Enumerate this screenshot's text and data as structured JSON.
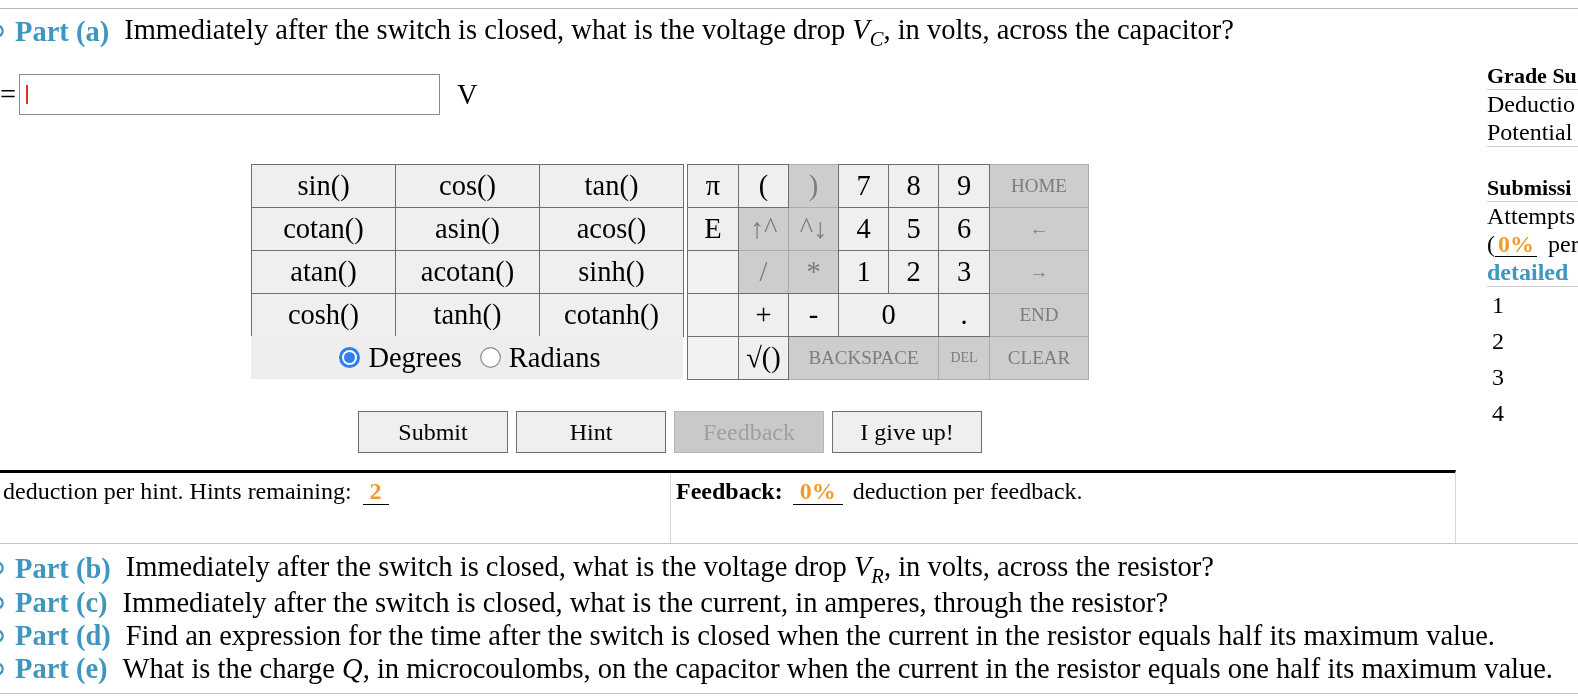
{
  "active_part": {
    "label": "Part (a)",
    "question": "Immediately after the switch is closed, what is the voltage drop *V*$_{C}$, in volts, across the capacitor?",
    "answer": {
      "prefix": "=",
      "unit": "V",
      "focused": true
    },
    "functions": [
      "sin()",
      "cos()",
      "tan()",
      "cotan()",
      "asin()",
      "acos()",
      "atan()",
      "acotan()",
      "sinh()",
      "cosh()",
      "tanh()",
      "cotanh()"
    ],
    "angle_modes": [
      {
        "label": "Degrees",
        "selected": true
      },
      {
        "label": "Radians",
        "selected": false
      }
    ],
    "keys": [
      {
        "label": "π",
        "kind": "char",
        "disabled": false
      },
      {
        "label": "(",
        "kind": "char",
        "disabled": false
      },
      {
        "label": ")",
        "kind": "char",
        "disabled": true
      },
      {
        "label": "7",
        "kind": "char",
        "disabled": false
      },
      {
        "label": "8",
        "kind": "char",
        "disabled": false
      },
      {
        "label": "9",
        "kind": "char",
        "disabled": false
      },
      {
        "label": "HOME",
        "kind": "command",
        "disabled": true
      },
      {
        "label": "E",
        "kind": "char",
        "disabled": false
      },
      {
        "label": "↑^",
        "kind": "char",
        "disabled": true
      },
      {
        "label": "^↓",
        "kind": "char",
        "disabled": true
      },
      {
        "label": "4",
        "kind": "char",
        "disabled": false
      },
      {
        "label": "5",
        "kind": "char",
        "disabled": false
      },
      {
        "label": "6",
        "kind": "char",
        "disabled": false
      },
      {
        "label": "←",
        "kind": "command",
        "disabled": true
      },
      {
        "kind": "blank"
      },
      {
        "label": "/",
        "kind": "char",
        "disabled": true
      },
      {
        "label": "*",
        "kind": "char",
        "disabled": true
      },
      {
        "label": "1",
        "kind": "char",
        "disabled": false
      },
      {
        "label": "2",
        "kind": "char",
        "disabled": false
      },
      {
        "label": "3",
        "kind": "char",
        "disabled": false
      },
      {
        "label": "→",
        "kind": "command",
        "disabled": true
      },
      {
        "kind": "blank"
      },
      {
        "label": "+",
        "kind": "char",
        "disabled": false
      },
      {
        "label": "-",
        "kind": "char",
        "disabled": false
      },
      {
        "label": "0",
        "kind": "wide",
        "disabled": false
      },
      {
        "label": ".",
        "kind": "char",
        "disabled": false
      },
      {
        "label": "END",
        "kind": "command",
        "disabled": true
      },
      {
        "kind": "blank"
      },
      {
        "label": "√()",
        "kind": "char",
        "disabled": false
      },
      {
        "label": "BACKSPACE",
        "kind": "long_command",
        "disabled": true
      },
      {
        "label": "DEL",
        "kind": "small_command",
        "disabled": true
      },
      {
        "label": "CLEAR",
        "kind": "command",
        "disabled": true
      }
    ],
    "buttons": [
      {
        "label": "Submit",
        "disabled": false
      },
      {
        "label": "Hint",
        "disabled": false
      },
      {
        "label": "Feedback",
        "disabled": true
      },
      {
        "label": "I give up!",
        "disabled": false
      }
    ],
    "hints": {
      "text": "deduction per hint. Hints remaining: **2**"
    },
    "feedback": {
      "label": "Feedback:",
      "text": "**0%** deduction per feedback."
    }
  },
  "grade_summary": {
    "title": "Grade Su",
    "rows": [
      "Deductio",
      "Potential"
    ]
  },
  "submissions": {
    "title": "Submissi",
    "lines": [
      "Attempts",
      "(**0%** per"
    ],
    "link": "detailed",
    "attempts": [
      "1",
      "2",
      "3",
      "4"
    ]
  },
  "other_parts": [
    {
      "label": "Part (b)",
      "question": "Immediately after the switch is closed, what is the voltage drop *V*$_{R}$, in volts, across the resistor?"
    },
    {
      "label": "Part (c)",
      "question": "Immediately after the switch is closed, what is the current, in amperes, through the resistor?"
    },
    {
      "label": "Part (d)",
      "question": "Find an expression for the time after the switch is closed when the current in the resistor equals half its maximum value."
    },
    {
      "label": "Part (e)",
      "question": "What is the charge *Q*, in microcoulombs, on the capacitor when the current in the resistor equals one half its maximum value."
    }
  ]
}
